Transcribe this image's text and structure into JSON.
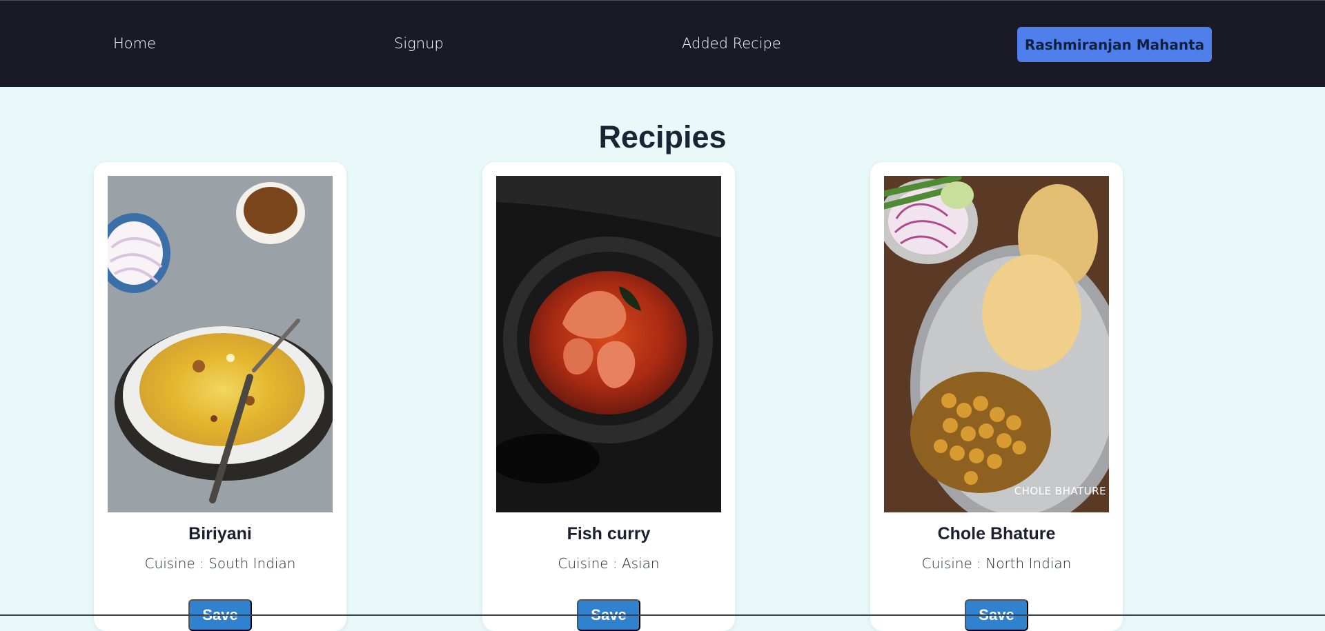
{
  "nav": {
    "home": "Home",
    "signup": "Signup",
    "added_recipe": "Added Recipe",
    "user_name": "Rashmiranjan Mahanta"
  },
  "page": {
    "title": "Recipies"
  },
  "recipes": [
    {
      "name": "Biriyani",
      "cuisine": "Cuisine : South Indian",
      "save_label": "Save",
      "image_icon": "biriyani-image"
    },
    {
      "name": "Fish curry",
      "cuisine": "Cuisine : Asian",
      "save_label": "Save",
      "image_icon": "fish-curry-image"
    },
    {
      "name": "Chole Bhature",
      "cuisine": "Cuisine : North Indian",
      "save_label": "Save",
      "image_icon": "chole-bhature-image",
      "image_watermark": "CHOLE BHATURE"
    }
  ],
  "colors": {
    "navbar": "#1a1a26",
    "accent_button": "#4f7fea",
    "save_button": "#3182ce",
    "page_background": "#e9f8f8"
  }
}
